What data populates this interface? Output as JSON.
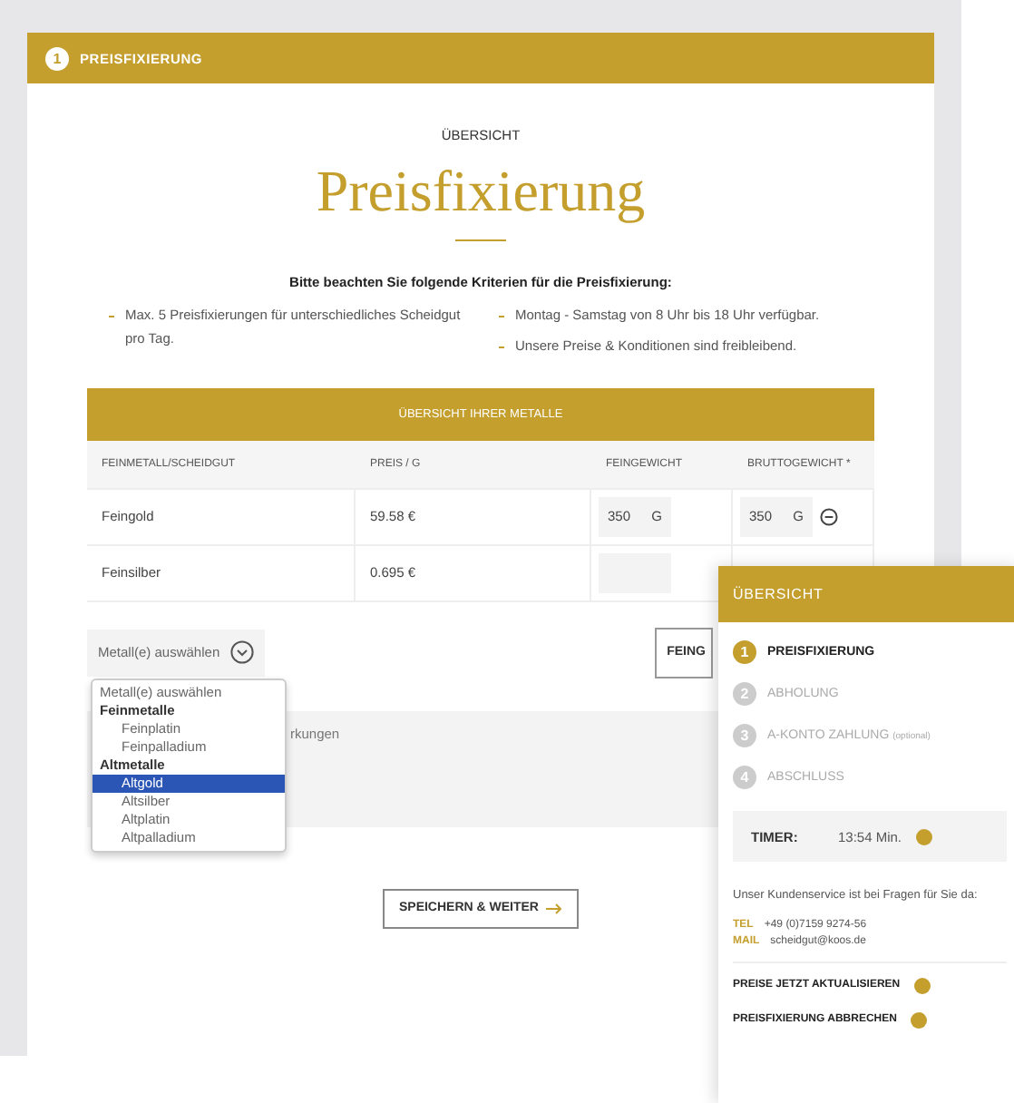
{
  "header": {
    "step_number": "1",
    "title": "PREISFIXIERUNG"
  },
  "overline": "ÜBERSICHT",
  "title": "Preisfixierung",
  "criteria": {
    "heading": "Bitte beachten Sie folgende Kriterien für die Preisfixierung:",
    "columns": [
      [
        "Max. 5 Preisfixierungen für unterschiedliches Scheidgut pro Tag."
      ],
      [
        "Montag - Samstag von 8 Uhr bis 18 Uhr verfügbar.",
        "Unsere Preise & Konditionen sind freibleibend."
      ]
    ]
  },
  "table": {
    "title": "ÜBERSICHT IHRER METALLE",
    "columns": [
      "FEINMETALL/SCHEIDGUT",
      "PREIS / G",
      "FEINGEWICHT",
      "BRUTTOGEWICHT *"
    ],
    "rows": [
      {
        "metal": "Feingold",
        "price": "59.58 €",
        "fine_weight": "350",
        "fine_unit": "G",
        "gross_weight": "350",
        "gross_unit": "G",
        "removable": true
      },
      {
        "metal": "Feinsilber",
        "price": "0.695 €",
        "fine_weight": "",
        "fine_unit": "",
        "removable": false
      }
    ]
  },
  "metal_select": {
    "placeholder": "Metall(e) auswählen",
    "expanded": true,
    "options": [
      {
        "kind": "option",
        "label": "Metall(e) auswählen",
        "selected": false
      },
      {
        "kind": "group",
        "label": "Feinmetalle"
      },
      {
        "kind": "option",
        "label": "Feinplatin",
        "selected": false
      },
      {
        "kind": "option",
        "label": "Feinpalladium",
        "selected": false
      },
      {
        "kind": "group",
        "label": "Altmetalle"
      },
      {
        "kind": "option",
        "label": "Altgold",
        "selected": true
      },
      {
        "kind": "option",
        "label": "Altsilber",
        "selected": false
      },
      {
        "kind": "option",
        "label": "Altplatin",
        "selected": false
      },
      {
        "kind": "option",
        "label": "Altpalladium",
        "selected": false
      }
    ]
  },
  "add_button": "FEING",
  "remarks_placeholder": "rkungen",
  "save_button": "SPEICHERN & WEITER",
  "sidebar": {
    "title": "ÜBERSICHT",
    "steps": [
      {
        "number": "1",
        "label": "PREISFIXIERUNG",
        "selected": true
      },
      {
        "number": "2",
        "label": "ABHOLUNG",
        "selected": false
      },
      {
        "number": "3",
        "label": "A-KONTO ZAHLUNG",
        "note": "(optional)",
        "selected": false
      },
      {
        "number": "4",
        "label": "ABSCHLUSS",
        "selected": false
      }
    ],
    "timer_label": "TIMER:",
    "timer_value": "13:54 Min.",
    "service_text": "Unser Kundenservice ist bei Fragen für Sie da:",
    "contacts": [
      {
        "label": "TEL",
        "value": "+49 (0)7159 9274-56"
      },
      {
        "label": "MAIL",
        "value": "scheidgut@koos.de"
      }
    ],
    "actions": [
      "PREISE JETZT AKTUALISIEREN",
      "PREISFIXIERUNG ABBRECHEN"
    ]
  }
}
